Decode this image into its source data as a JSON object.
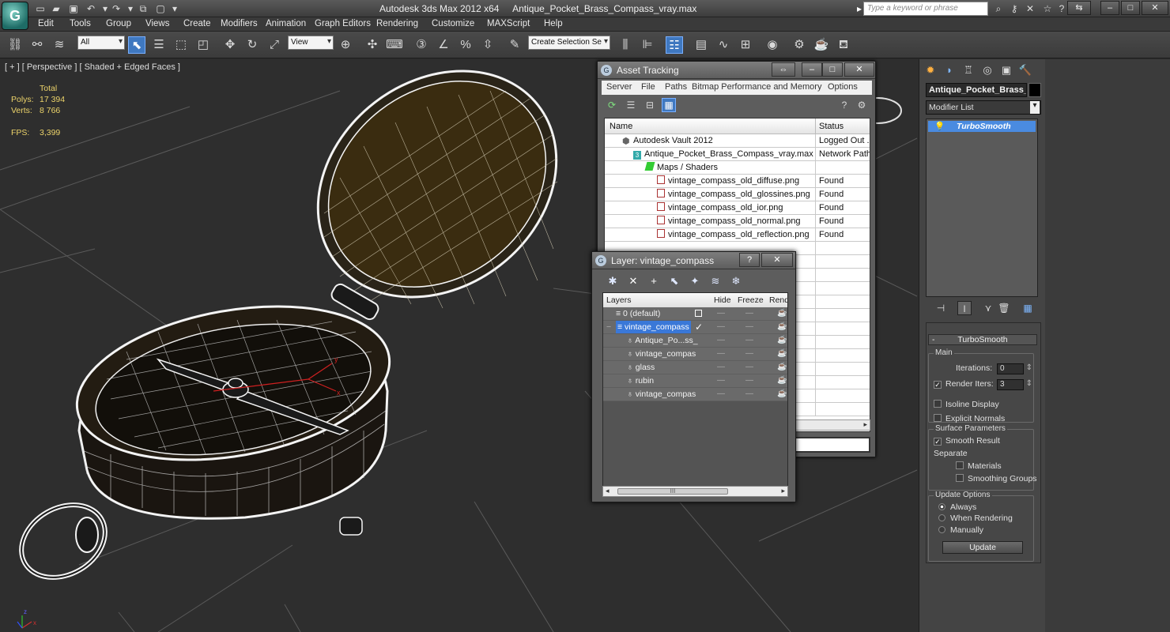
{
  "app": {
    "logo": "G",
    "title_app": "Autodesk 3ds Max  2012 x64",
    "title_file": "Antique_Pocket_Brass_Compass_vray.max",
    "search_placeholder": "Type a keyword or phrase"
  },
  "menu": [
    "Edit",
    "Tools",
    "Group",
    "Views",
    "Create",
    "Modifiers",
    "Animation",
    "Graph Editors",
    "Rendering",
    "Customize",
    "MAXScript",
    "Help"
  ],
  "toolbar": {
    "filter_value": "All",
    "ref_coord_value": "View",
    "selection_set_value": "Create Selection Se"
  },
  "viewport": {
    "label": "[ + ] [ Perspective ] [ Shaded + Edged Faces ]",
    "stats_header": "Total",
    "polys_label": "Polys:",
    "polys_value": "17 394",
    "verts_label": "Verts:",
    "verts_value": "8 766",
    "fps_label": "FPS:",
    "fps_value": "3,399",
    "axis_y": "y",
    "axis_x": "x",
    "axis_z": "z"
  },
  "command_panel": {
    "object_name": "Antique_Pocket_Brass_C",
    "modifier_list": "Modifier List",
    "modifier_item": "TurboSmooth",
    "rollout_title": "TurboSmooth",
    "main_group": "Main",
    "iterations_label": "Iterations:",
    "iterations_value": "0",
    "render_iters_label": "Render Iters:",
    "render_iters_value": "3",
    "isoline_display": "Isoline Display",
    "explicit_normals": "Explicit Normals",
    "surface_params_group": "Surface Parameters",
    "smooth_result": "Smooth Result",
    "separate_label": "Separate",
    "materials": "Materials",
    "smoothing_groups": "Smoothing Groups",
    "update_options_group": "Update Options",
    "always": "Always",
    "when_rendering": "When Rendering",
    "manually": "Manually",
    "update_button": "Update"
  },
  "asset_tracking": {
    "title": "Asset Tracking",
    "menu": [
      "Server",
      "File",
      "Paths",
      "Bitmap Performance and Memory",
      "Options"
    ],
    "col_name": "Name",
    "col_status": "Status",
    "rows": [
      {
        "name": "Autodesk Vault 2012",
        "status": "Logged Out ..."
      },
      {
        "name": "Antique_Pocket_Brass_Compass_vray.max",
        "status": "Network Path"
      },
      {
        "name": "Maps / Shaders",
        "status": ""
      },
      {
        "name": "vintage_compass_old_diffuse.png",
        "status": "Found"
      },
      {
        "name": "vintage_compass_old_glossines.png",
        "status": "Found"
      },
      {
        "name": "vintage_compass_old_ior.png",
        "status": "Found"
      },
      {
        "name": "vintage_compass_old_normal.png",
        "status": "Found"
      },
      {
        "name": "vintage_compass_old_reflection.png",
        "status": "Found"
      }
    ]
  },
  "layer_window": {
    "title": "Layer: vintage_compass",
    "help": "?",
    "col_layers": "Layers",
    "col_hide": "Hide",
    "col_freeze": "Freeze",
    "col_render": "Rende",
    "rows": [
      {
        "name": "0 (default)"
      },
      {
        "name": "vintage_compass"
      },
      {
        "name": "Antique_Po...ss_"
      },
      {
        "name": "vintage_compas"
      },
      {
        "name": "glass"
      },
      {
        "name": "rubin"
      },
      {
        "name": "vintage_compas"
      }
    ],
    "dash": "—",
    "scroll_grip": "III"
  },
  "colors": {
    "accent": "#3a78d8",
    "stats": "#ecd36a",
    "modifier_highlight": "#4a8be0"
  }
}
